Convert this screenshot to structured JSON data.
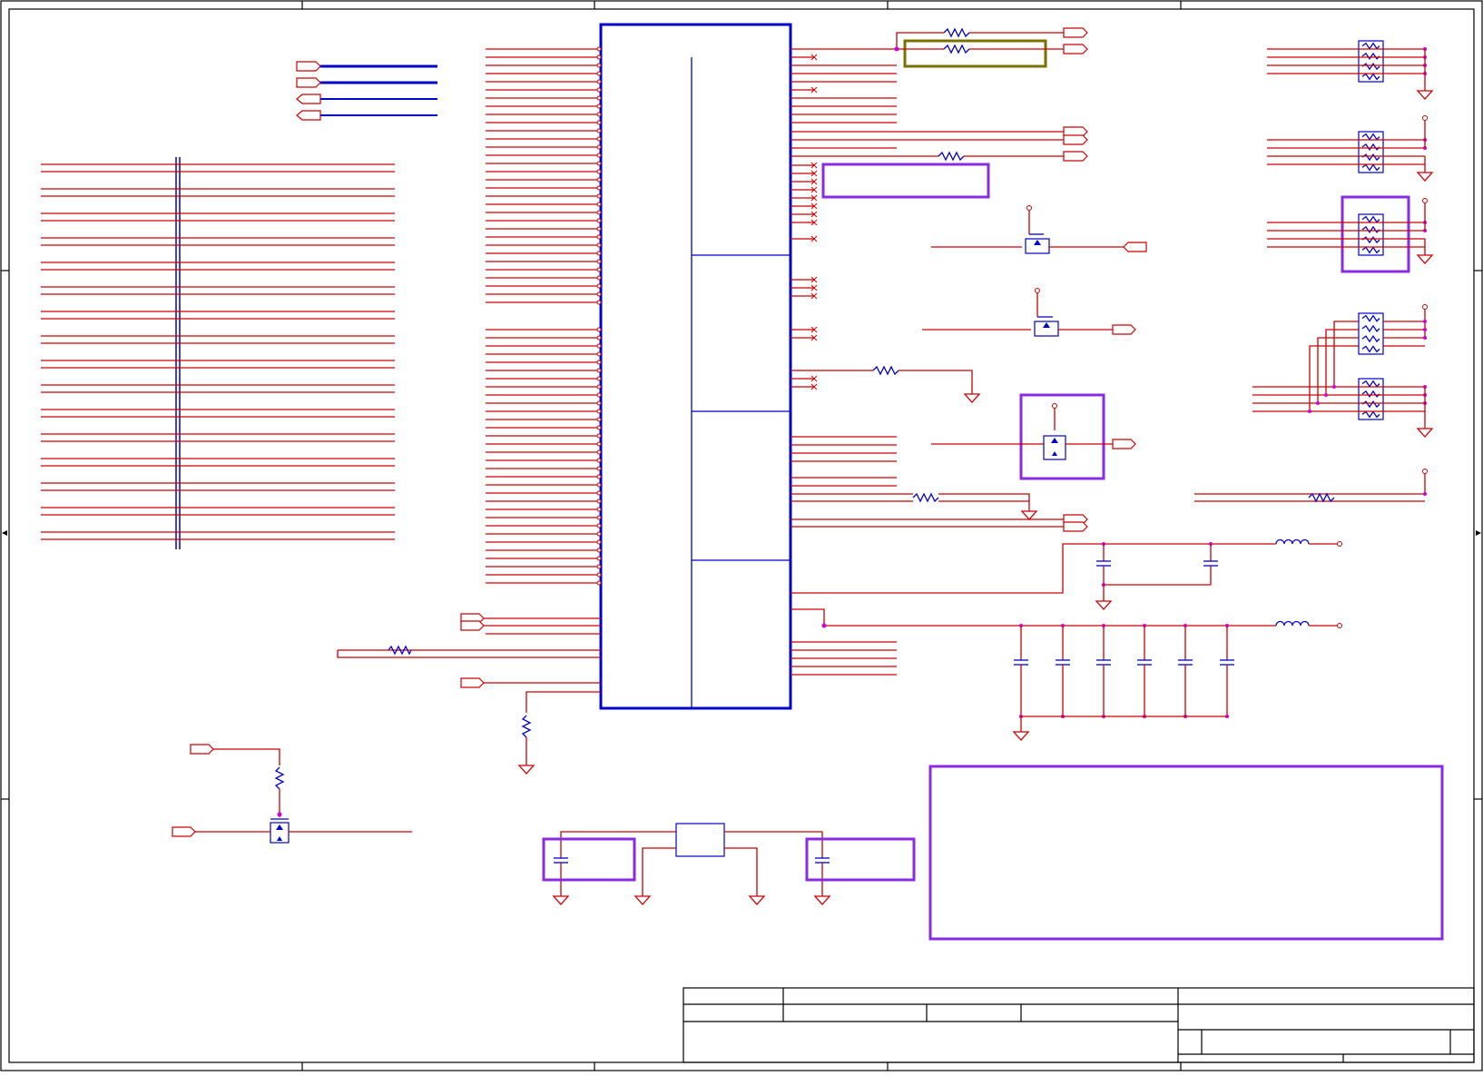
{
  "schematic": {
    "sheet": {
      "zones_top": [
        "",
        "",
        "",
        ""
      ],
      "zones_side": [
        "",
        ""
      ]
    },
    "title_block": {
      "company": "",
      "title": "",
      "size": "",
      "document_number": "",
      "revision": "",
      "date": "",
      "sheet": ""
    },
    "main_ic": {
      "designator": "",
      "value": ""
    },
    "regulator": {
      "designator": "",
      "value": ""
    },
    "notes_box": {
      "text": ""
    }
  }
}
